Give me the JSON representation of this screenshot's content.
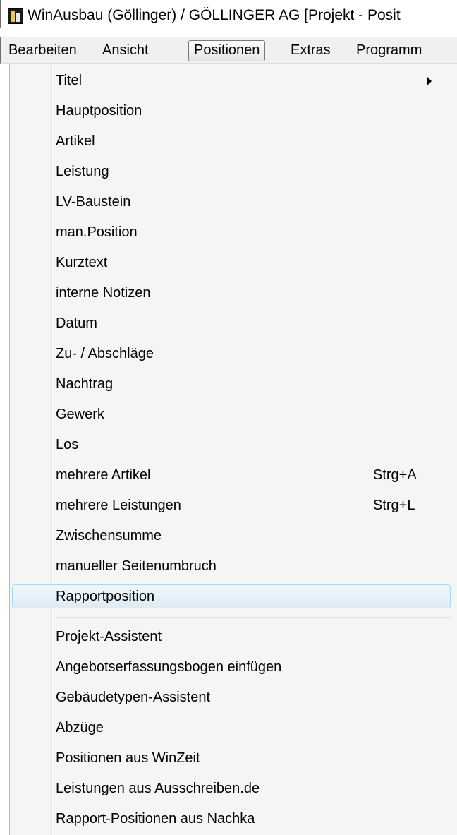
{
  "window": {
    "title": "WinAusbau (Göllinger) / GÖLLINGER AG [Projekt - Posit"
  },
  "menubar": {
    "items": [
      {
        "label": "Bearbeiten"
      },
      {
        "label": "Ansicht"
      },
      {
        "label": "Positionen",
        "active": true
      },
      {
        "label": "Extras"
      },
      {
        "label": "Programm"
      }
    ]
  },
  "menu": {
    "items": [
      {
        "label": "Titel",
        "submenu": true
      },
      {
        "label": "Hauptposition"
      },
      {
        "label": "Artikel"
      },
      {
        "label": "Leistung"
      },
      {
        "label": "LV-Baustein"
      },
      {
        "label": "man.Position"
      },
      {
        "label": "Kurztext"
      },
      {
        "label": "interne Notizen"
      },
      {
        "label": "Datum"
      },
      {
        "label": "Zu- / Abschläge"
      },
      {
        "label": "Nachtrag"
      },
      {
        "label": "Gewerk"
      },
      {
        "label": "Los"
      },
      {
        "label": "mehrere Artikel",
        "shortcut": "Strg+A"
      },
      {
        "label": "mehrere Leistungen",
        "shortcut": "Strg+L"
      },
      {
        "label": "Zwischensumme"
      },
      {
        "label": "manueller Seitenumbruch"
      },
      {
        "label": "Rapportposition",
        "highlighted": true
      },
      {
        "label": "Projekt-Assistent"
      },
      {
        "label": "Angebotserfassungsbogen einfügen"
      },
      {
        "label": "Gebäudetypen-Assistent"
      },
      {
        "label": "Abzüge"
      },
      {
        "label": "Positionen aus WinZeit"
      },
      {
        "label": "Leistungen aus Ausschreiben.de"
      },
      {
        "label": "Rapport-Positionen aus Nachka"
      }
    ]
  },
  "colors": {
    "highlight_border": "#a8d8eb",
    "menu_background": "#f5f5f5",
    "menubar_background": "#f0f0f0"
  }
}
